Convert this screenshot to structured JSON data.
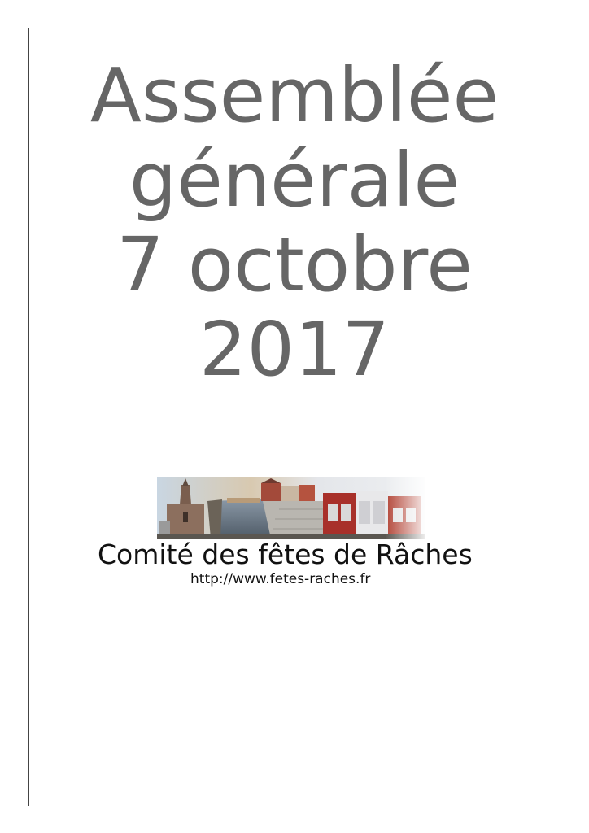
{
  "title": {
    "lines": [
      "Assemblée",
      "générale",
      "7 octobre",
      "2017"
    ]
  },
  "logo": {
    "name": "Comité des fêtes de Râches",
    "url": "http://www.fetes-raches.fr"
  },
  "colors": {
    "title_text": "#666666",
    "body_text": "#111111",
    "margin_rule": "#444444"
  }
}
